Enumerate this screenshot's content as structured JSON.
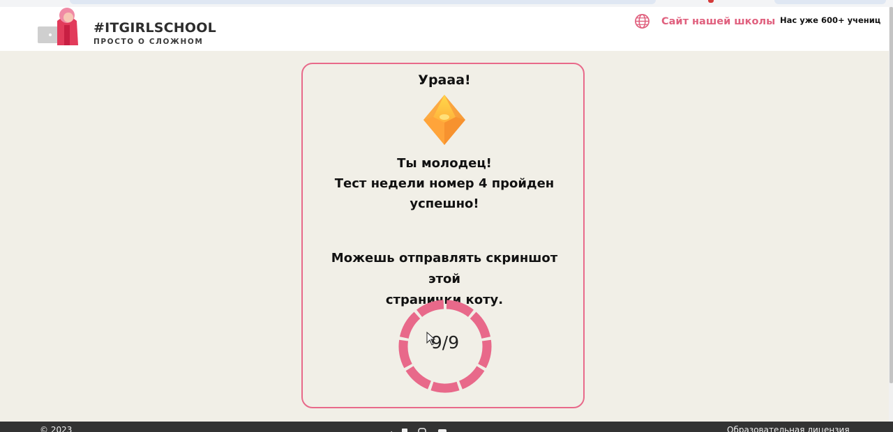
{
  "header": {
    "brand_name": "#ITGIRLSCHOOL",
    "brand_tagline": "ПРОСТО О СЛОЖНОМ",
    "site_link": "Сайт нашей школы",
    "students_note": "Нас уже 600+ учениц"
  },
  "result": {
    "title": "Урааа!",
    "praise_line1": "Ты молодец!",
    "praise_line2": "Тест недели номер 4 пройден",
    "praise_line3": "успешно!",
    "instruction_line1": "Можешь отправлять скриншот этой",
    "instruction_line2": "странички коту.",
    "score": "9/9",
    "correct": 9,
    "total": 9
  },
  "footer": {
    "copyright": "© 2023",
    "license": "Образовательная лицензия"
  },
  "colors": {
    "accent": "#e8698a",
    "background": "#f1efe7",
    "footer": "#333333"
  },
  "icons": [
    "globe-icon",
    "gem-icon",
    "cursor-icon",
    "social-icons"
  ]
}
